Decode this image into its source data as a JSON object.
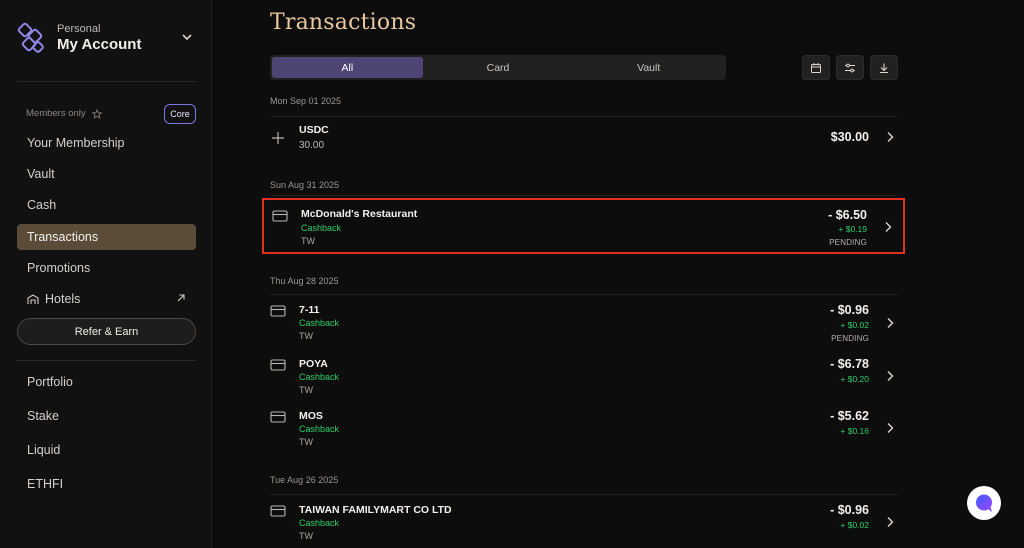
{
  "account": {
    "label": "Personal",
    "name": "My Account"
  },
  "sidebar": {
    "members_label": "Members only",
    "core_badge": "Core",
    "items": [
      {
        "label": "Your Membership"
      },
      {
        "label": "Vault"
      },
      {
        "label": "Cash"
      },
      {
        "label": "Transactions",
        "active": true
      },
      {
        "label": "Promotions"
      },
      {
        "label": "Hotels"
      }
    ],
    "refer_label": "Refer & Earn",
    "items2": [
      {
        "label": "Portfolio"
      },
      {
        "label": "Stake"
      },
      {
        "label": "Liquid"
      },
      {
        "label": "ETHFI"
      }
    ]
  },
  "main": {
    "title": "Transactions",
    "tabs": [
      {
        "label": "All",
        "active": true
      },
      {
        "label": "Card"
      },
      {
        "label": "Vault"
      }
    ],
    "toolbar": [
      "calendar-icon",
      "filter-sliders-icon",
      "download-icon"
    ]
  },
  "groups": [
    {
      "date": "Mon Sep 01 2025",
      "txns": [
        {
          "icon": "plus-icon",
          "name": "USDC",
          "sub2": "30.00",
          "amount": "$30.00"
        }
      ]
    },
    {
      "date": "Sun Aug 31 2025",
      "txns": [
        {
          "icon": "card-icon",
          "name": "McDonald's Restaurant",
          "sub": "Cashback",
          "sub2": "TW",
          "amount": "- $6.50",
          "cashback": "+ $0.19",
          "status": "PENDING",
          "highlighted": true
        }
      ]
    },
    {
      "date": "Thu Aug 28 2025",
      "txns": [
        {
          "icon": "card-icon",
          "name": "7-11",
          "sub": "Cashback",
          "sub2": "TW",
          "amount": "- $0.96",
          "cashback": "+ $0.02",
          "status": "PENDING"
        },
        {
          "icon": "card-icon",
          "name": "POYA",
          "sub": "Cashback",
          "sub2": "TW",
          "amount": "- $6.78",
          "cashback": "+ $0.20"
        },
        {
          "icon": "card-icon",
          "name": "MOS",
          "sub": "Cashback",
          "sub2": "TW",
          "amount": "- $5.62",
          "cashback": "+ $0.16"
        }
      ]
    },
    {
      "date": "Tue Aug 26 2025",
      "txns": [
        {
          "icon": "card-icon",
          "name": "TAIWAN FAMILYMART CO LTD",
          "sub": "Cashback",
          "sub2": "TW",
          "amount": "- $0.96",
          "cashback": "+ $0.02"
        }
      ]
    }
  ],
  "colors": {
    "accent_gold": "#e8c9a1",
    "active_nav": "#5a4c39",
    "active_tab": "#4e4575",
    "cashback_green": "#2ecf6a",
    "highlight_red": "#e1301e"
  }
}
